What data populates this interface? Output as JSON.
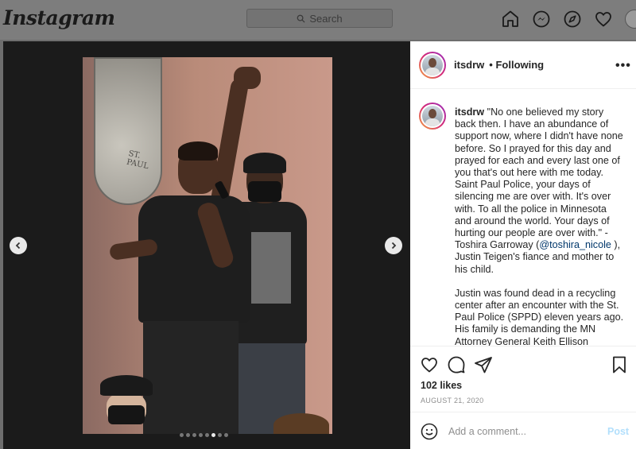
{
  "nav": {
    "logo": "Instagram",
    "search_placeholder": "Search",
    "icons": [
      "home-icon",
      "messenger-icon",
      "explore-icon",
      "heart-icon",
      "profile-avatar"
    ]
  },
  "post": {
    "username": "itsdrw",
    "follow_status": "• Following",
    "more_label": "•••",
    "caption_user": "itsdrw",
    "caption_part1": " \"No one believed my story back then. I have an abundance of support now, where I didn't have none before. So I prayed for this day and prayed for each and every last one of you that's out here with me today. Saint Paul Police, your days of silencing me are over with. It's over with. To all the police in Minnesota and around the world. Your days of hurting our people are over with.\" - Toshira Garroway (",
    "caption_mention": "@toshira_nicole",
    "caption_part2": " ), Justin Teigen's fiance and mother to his child.",
    "caption_para2": "Justin was found dead in a recycling center after an encounter with the St. Paul Police (SPPD) eleven years ago. His family is demanding the MN Attorney General Keith Ellison",
    "likes": "102 likes",
    "date": "AUGUST 21, 2020",
    "comment_placeholder": "Add a comment...",
    "post_button": "Post",
    "carousel": {
      "total": 8,
      "active_index": 5
    },
    "seal_text": "ST. PAUL"
  }
}
